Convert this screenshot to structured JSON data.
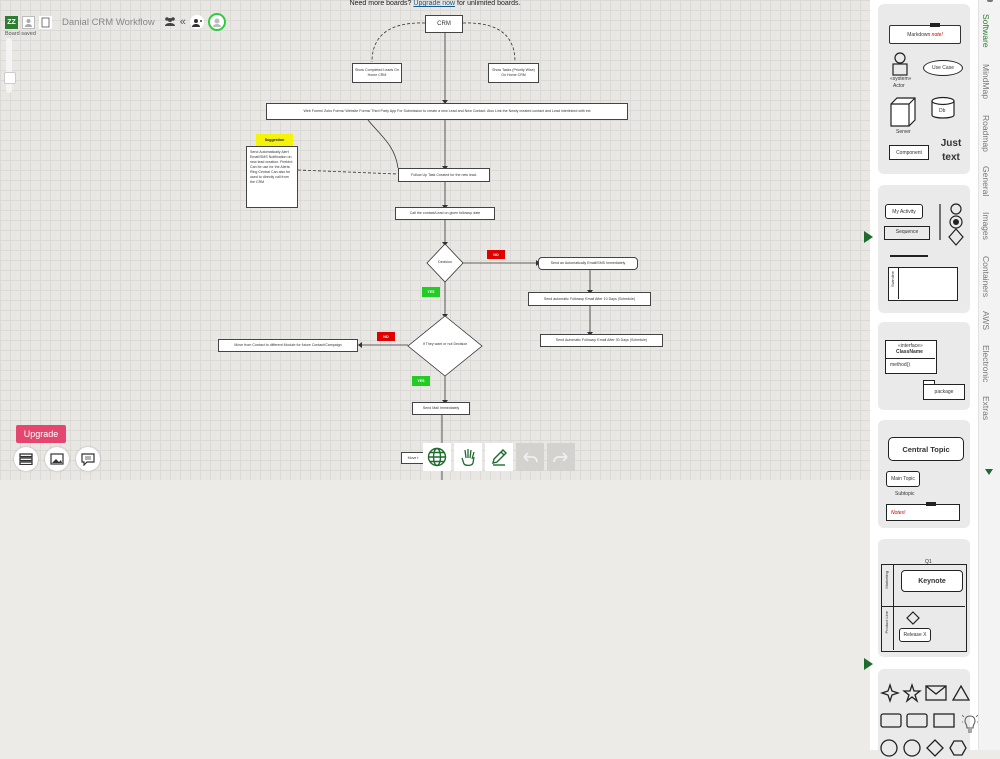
{
  "banner": {
    "prefix": "Need more boards?",
    "link": "Upgrade now",
    "suffix": "for unlimited boards."
  },
  "header": {
    "logo": "ZZ",
    "title": "Danial CRM Workflow",
    "status": "Board saved"
  },
  "actions": {
    "upgrade": "Upgrade"
  },
  "flowchart": {
    "crm": "CRM",
    "show_completed": "Show Completed Leads On Home CRM",
    "show_tasks": "Show Tasks (Priority Wise) On Home CRM",
    "web_forms": "Web Forms/ Zoho Forms/ Website Forms/ Third Party App For Submission to create a new Lead and New Contact. Also Link the Newly created contact and Lead interlinked with ext",
    "suggestion_tag": "Suggestion",
    "suggestion_note": "Send Automatically Alert Email/SMS Notification on new lead creation. Firebird Can be use for the Alerts. Ring Central Can also be used to directly call from the CRM",
    "follow_up": "Follow Up Task Created for the new lead.",
    "call_contact": "Call the contact/Lead on given followup date",
    "decision": "Decision",
    "no_tag": "NO",
    "yes_tag": "YES",
    "send_auto": "Send an Automatically Email/SMS Immediately",
    "auto_followup_10": "Send automatic Followup Email After 10 Days (Schedule)",
    "auto_followup_30": "Send Automatic Followup Email After 30 Days (Schedule)",
    "decision2": "If They want or not Decision",
    "no_tag2": "NO",
    "move_contact": "Move from Contact to different Module for future Contact/Campaign",
    "yes_tag2": "YES",
    "send_mail": "Send Mail Immediately",
    "move_partial": "Move t"
  },
  "shelf": {
    "tabs": [
      "Software",
      "MindMap",
      "Roadmap",
      "General",
      "Images",
      "Containers",
      "AWS",
      "Electronic",
      "Extras"
    ],
    "software": {
      "markdown": "Markdown",
      "note": "note!",
      "actor_stereo": "«system»",
      "actor": "Actor",
      "use_case": "Use Case",
      "server": "Server",
      "db": "Db",
      "component": "Component",
      "just_text": "Just text"
    },
    "sequence": {
      "my_activity": "My Activity",
      "sequence": "Sequence",
      "swimline": "Swimline"
    },
    "class": {
      "interface": "«interface»",
      "class_name": "ClassName",
      "method": "method()",
      "package": "package"
    },
    "mindmap": {
      "central": "Central Topic",
      "main": "Main Topic",
      "sub": "Subtopic",
      "notes": "Notes!"
    },
    "roadmap": {
      "q1": "Q1",
      "keynote": "Keynote",
      "marketing": "Marketing",
      "product": "Product Line",
      "release": "Release X"
    }
  },
  "colors": {
    "accent": "#2e7d32",
    "upgrade": "#e4466f",
    "suggestion": "#f6f30a",
    "no": "#e00000",
    "yes": "#22cc22"
  }
}
